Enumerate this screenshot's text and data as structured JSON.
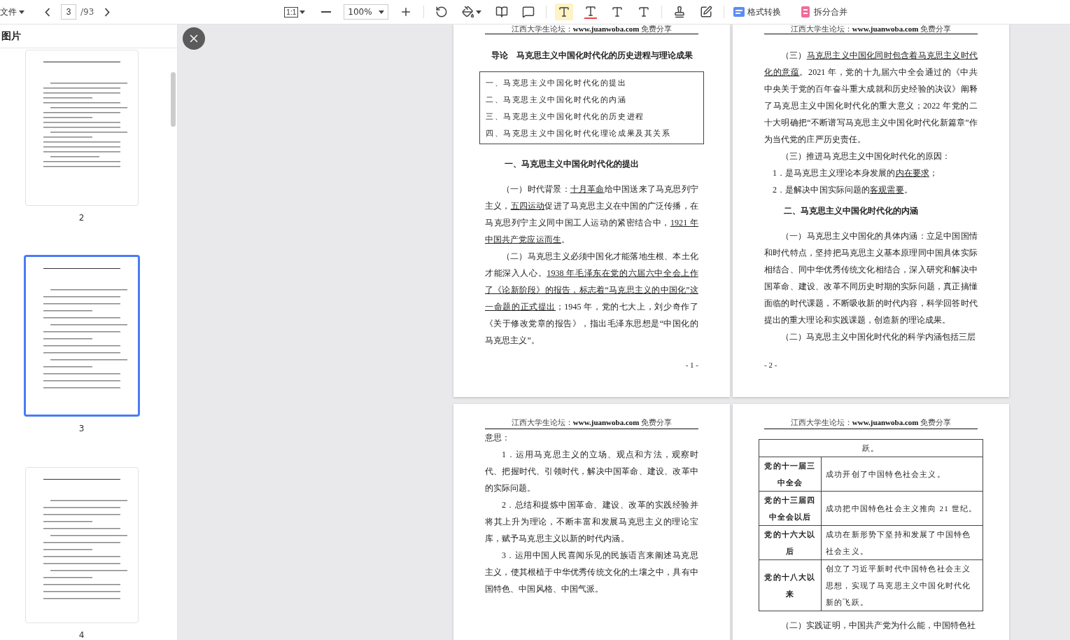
{
  "toolbar": {
    "file_menu": "文件",
    "page_input": "3",
    "page_total": "/93",
    "fit_label": "1:1",
    "zoom": "100%",
    "convert": "格式转换",
    "split_merge": "拆分合并"
  },
  "sidebar": {
    "title": "图片",
    "thumbnails": [
      {
        "page": "2",
        "selected": false
      },
      {
        "page": "3",
        "selected": true
      },
      {
        "page": "4",
        "selected": false
      }
    ]
  },
  "pages": [
    {
      "header": "江西大学生论坛：**www.juanwoba.com** 免费分享",
      "footer": "- 1 -",
      "blocks": [
        {
          "kind": "title",
          "text": "导论　马克思主义中国化时代化的历史进程与理论成果"
        },
        {
          "kind": "toc",
          "items": [
            "一、马克思主义中国化时代化的提出",
            "二、马克思主义中国化时代化的内涵",
            "三、马克思主义中国化时代化的历史进程",
            "四、马克思主义中国化时代化理论成果及其关系"
          ]
        },
        {
          "kind": "heading",
          "text": "一、马克思主义中国化时代化的提出"
        },
        {
          "kind": "paragraph",
          "continued": false,
          "segments": [
            {
              "text": "（一）时代背景：",
              "underlined": false
            },
            {
              "text": "十月革命",
              "underlined": true
            },
            {
              "text": "给中国送来了马克思列宁主义，",
              "underlined": false
            },
            {
              "text": "五四运动",
              "underlined": true
            },
            {
              "text": "促进了马克思主义在中国的广泛传播，在马克思列宁主义同中国工人运动的紧密结合中，",
              "underlined": false
            },
            {
              "text": "1921 年中国共产党应运而生",
              "underlined": true
            },
            {
              "text": "。",
              "underlined": false
            }
          ]
        },
        {
          "kind": "paragraph",
          "continued": false,
          "segments": [
            {
              "text": "（二）马克思主义必须中国化才能落地生根、本土化才能深入人心。",
              "underlined": false
            },
            {
              "text": "1938 年毛泽东在党的六届六中全会上作了《论新阶段》的报告，标志着“马克思主义的中国化”这一命题的正式提出",
              "underlined": true
            },
            {
              "text": "；1945 年，党的七大上，刘少奇作了《关于修改党章的报告》，指出毛泽东思想是“中国化的马克思主义”。",
              "underlined": false
            }
          ]
        }
      ]
    },
    {
      "header": "江西大学生论坛：**www.juanwoba.com** 免费分享",
      "footer": "- 2 -",
      "blocks": [
        {
          "kind": "paragraph",
          "continued": false,
          "segments": [
            {
              "text": "（三）",
              "underlined": false
            },
            {
              "text": "马克思主义中国化同时包含着马克思主义时代化的意蕴",
              "underlined": true
            },
            {
              "text": "。2021 年，党的十九届六中全会通过的《中共中央关于党的百年奋斗重大成就和历史经验的决议》阐释了马克思主义中国化时代化的重大意义；2022 年党的二十大明确把“不断谱写马克思主义中国化时代化新篇章”作为当代党的庄严历史责任。",
              "underlined": false
            }
          ]
        },
        {
          "kind": "paragraph",
          "continued": false,
          "segments": [
            {
              "text": "（三）推进马克思主义中国化时代化的原因：",
              "underlined": false
            }
          ]
        },
        {
          "kind": "list_item",
          "segments": [
            {
              "text": "1．是马克思主义理论本身发展的",
              "underlined": false
            },
            {
              "text": "内在要求",
              "underlined": true
            },
            {
              "text": "；",
              "underlined": false
            }
          ]
        },
        {
          "kind": "list_item",
          "segments": [
            {
              "text": "2．是解决中国实际问题的",
              "underlined": false
            },
            {
              "text": "客观需要",
              "underlined": true
            },
            {
              "text": "。",
              "underlined": false
            }
          ]
        },
        {
          "kind": "heading",
          "text": "二、马克思主义中国化时代化的内涵"
        },
        {
          "kind": "paragraph",
          "continued": false,
          "segments": [
            {
              "text": "（一）马克思主义中国化的具体内涵：立足中国国情和时代特点，坚持把马克思主义基本原理同中国具体实际相结合、同中华优秀传统文化相结合，深入研究和解决中国革命、建设、改革不同历史时期的实际问题，真正搞懂面临的时代课题，不断吸收新的时代内容，科学回答时代提出的重大理论和实践课题，创造新的理论成果。",
              "underlined": false
            }
          ]
        },
        {
          "kind": "paragraph",
          "continued": false,
          "segments": [
            {
              "text": "（二）马克思主义中国化时代化的科学内涵包括三层",
              "underlined": false
            }
          ]
        }
      ]
    },
    {
      "header": "江西大学生论坛：**www.juanwoba.com** 免费分享",
      "blocks": [
        {
          "kind": "paragraph",
          "continued": true,
          "segments": [
            {
              "text": "意思：",
              "underlined": false
            }
          ]
        },
        {
          "kind": "paragraph",
          "continued": false,
          "segments": [
            {
              "text": "1．运用马克思主义的立场、观点和方法，观察时代、把握时代、引领时代，解决中国革命、建设、改革中的实际问题。",
              "underlined": false
            }
          ]
        },
        {
          "kind": "paragraph",
          "continued": false,
          "segments": [
            {
              "text": "2．总结和提炼中国革命、建设、改革的实践经验并将其上升为理论，不断丰富和发展马克思主义的理论宝库，赋予马克思主义以新的时代内涵。",
              "underlined": false
            }
          ]
        },
        {
          "kind": "paragraph",
          "continued": false,
          "segments": [
            {
              "text": "3．运用中国人民喜闻乐见的民族语言来阐述马克思主义，使其根植于中华优秀传统文化的土壤之中，具有中国特色、中国风格、中国气派。",
              "underlined": false
            }
          ]
        }
      ]
    },
    {
      "header": "江西大学生论坛：**www.juanwoba.com** 免费分享",
      "blocks": [
        {
          "kind": "table",
          "top": "跃。",
          "rows": [
            {
              "period": "党的十一届三中全会",
              "result": "成功开创了中国特色社会主义。"
            },
            {
              "period": "党的十三届四中全会以后",
              "result": "成功把中国特色社会主义推向 21 世纪。"
            },
            {
              "period": "党的十六大以后",
              "result": "成功在新形势下坚持和发展了中国特色社会主义。"
            },
            {
              "period": "党的十八大以来",
              "result": "创立了习近平新时代中国特色社会主义思想，实现了马克思主义中国化时代化新的飞跃。"
            }
          ]
        },
        {
          "kind": "paragraph",
          "continued": false,
          "segments": [
            {
              "text": "（二）实践证明，中国共产党为什么能，中国特色社",
              "underlined": false
            }
          ]
        }
      ]
    }
  ]
}
